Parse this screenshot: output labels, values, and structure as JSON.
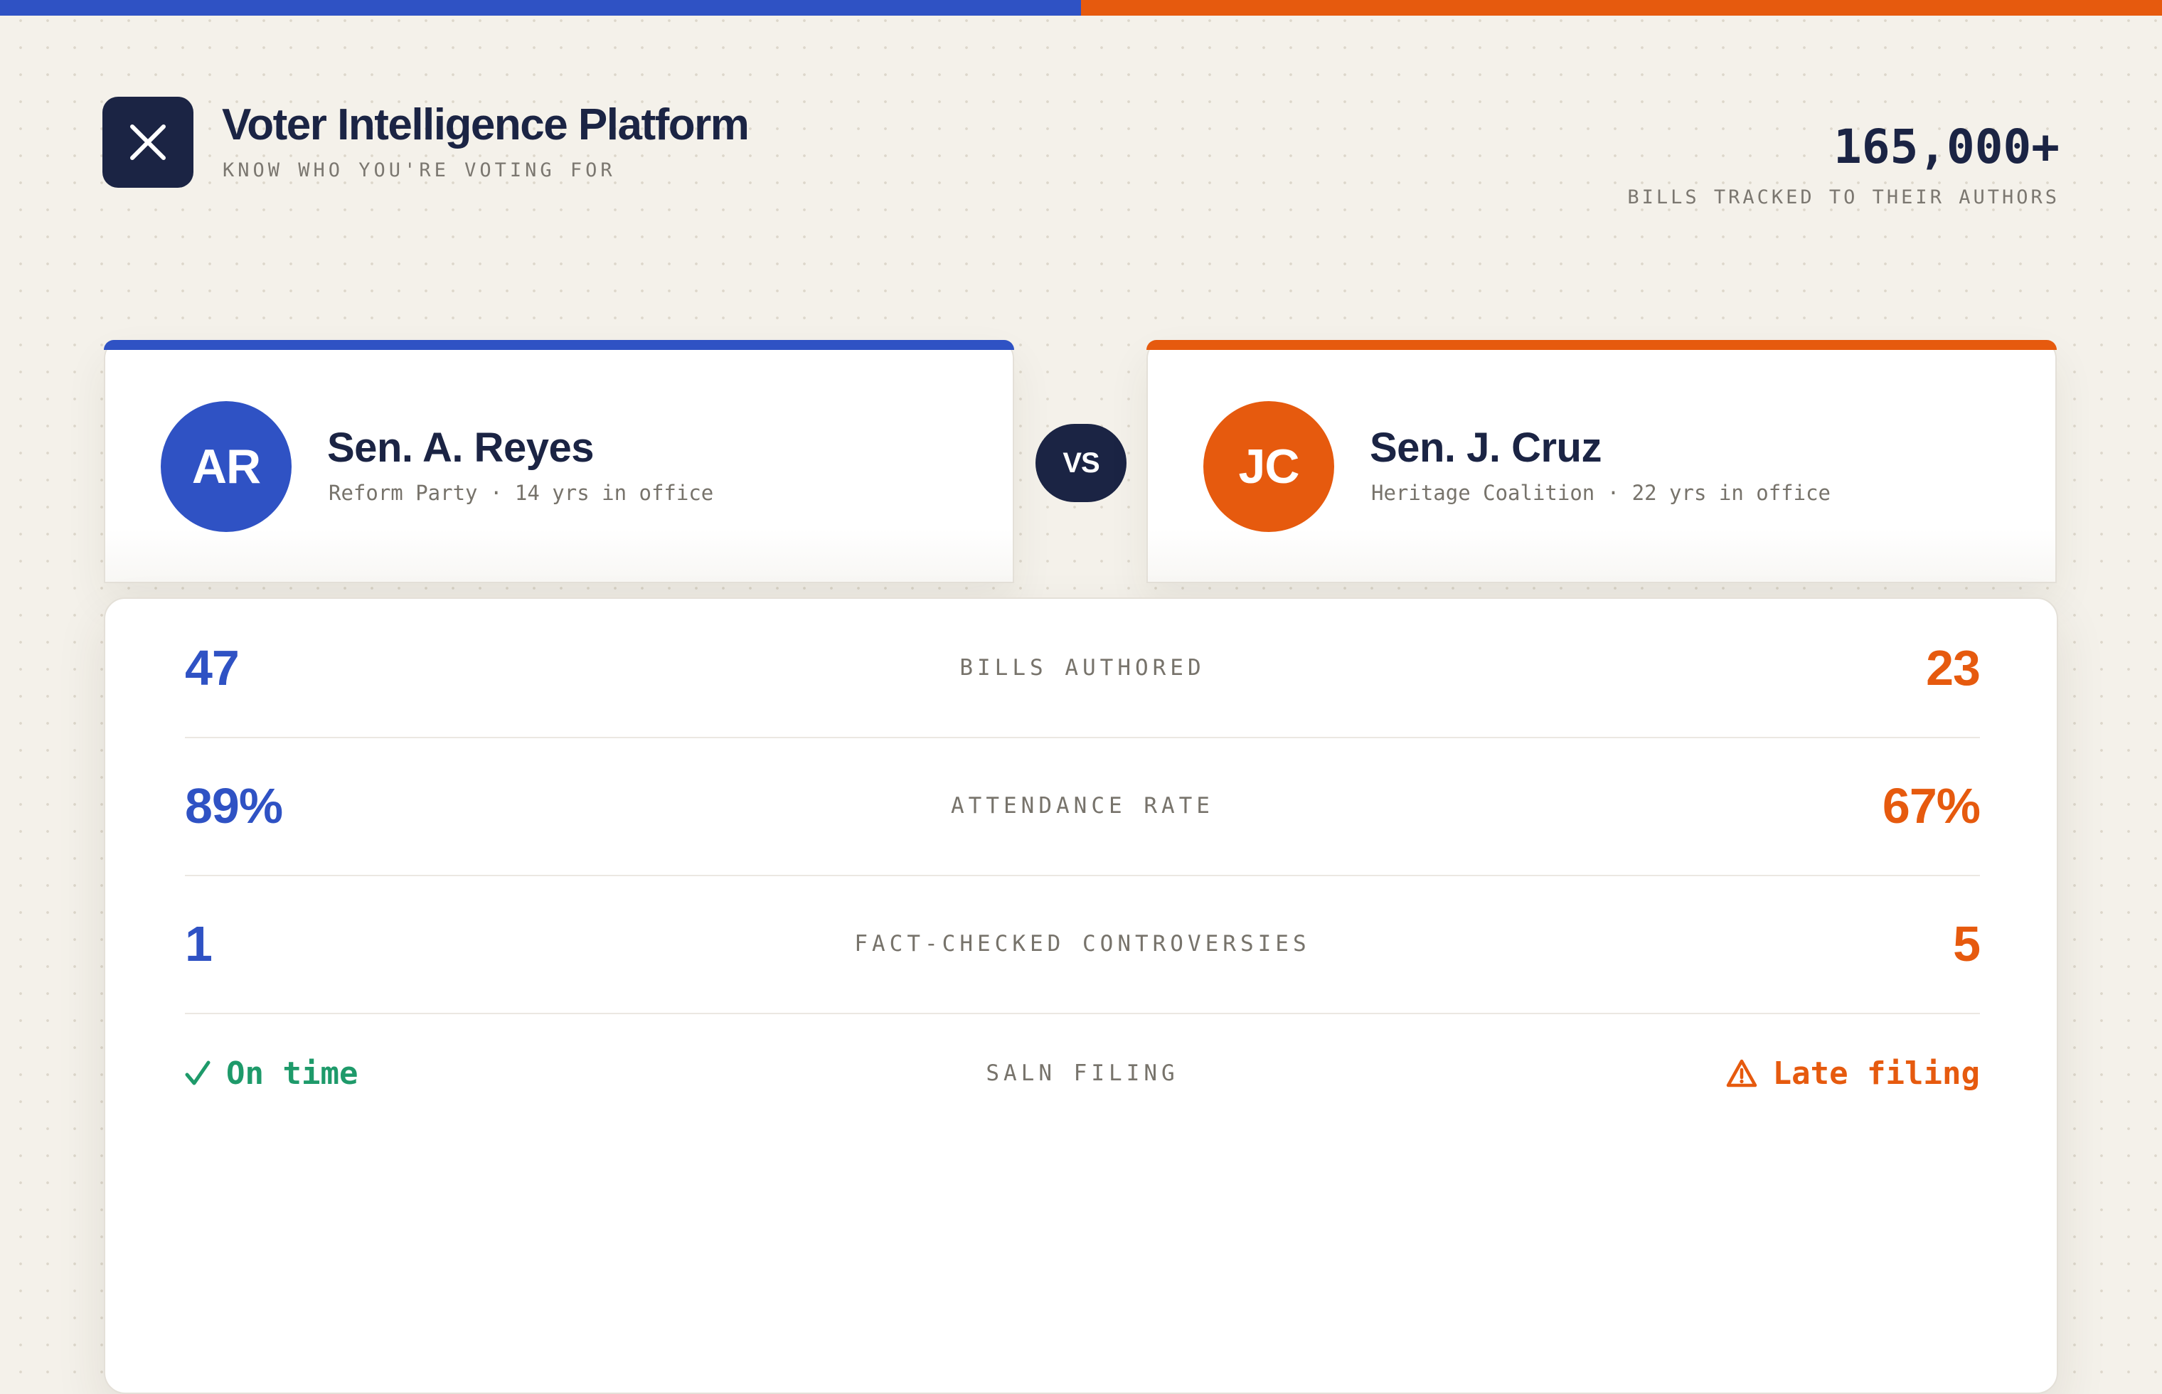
{
  "app": {
    "title": "Voter Intelligence Platform",
    "subtitle": "KNOW WHO YOU'RE VOTING FOR",
    "logo_icon": "close-x-icon"
  },
  "stats": {
    "value": "165,000+",
    "label": "BILLS TRACKED TO THEIR AUTHORS"
  },
  "colors": {
    "blue": "#2f52c4",
    "orange": "#e65a0e",
    "navy": "#1b2444",
    "green": "#1e9a6a"
  },
  "candidates": [
    {
      "initials": "AR",
      "name": "Sen. A. Reyes",
      "meta": "Reform Party · 14 yrs in office"
    },
    {
      "initials": "JC",
      "name": "Sen. J. Cruz",
      "meta": "Heritage Coalition · 22 yrs in office"
    }
  ],
  "vs_label": "VS",
  "metrics": [
    {
      "label": "BILLS AUTHORED",
      "left": "47",
      "right": "23"
    },
    {
      "label": "ATTENDANCE RATE",
      "left": "89%",
      "right": "67%"
    },
    {
      "label": "FACT-CHECKED CONTROVERSIES",
      "left": "1",
      "right": "5"
    }
  ],
  "saln": {
    "label": "SALN FILING",
    "left": {
      "text": "On time",
      "icon": "checkmark-icon"
    },
    "right": {
      "text": "Late filing",
      "icon": "warning-icon"
    }
  }
}
